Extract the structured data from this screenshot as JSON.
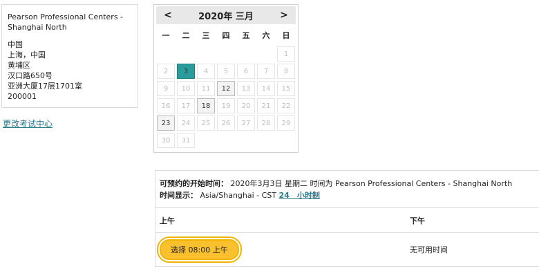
{
  "center": {
    "name": "Pearson Professional Centers - Shanghai North",
    "address": [
      "中国",
      "上海，中国",
      "黄埔区",
      "汉口路650号",
      "亚洲大厦17层1701室",
      "200001"
    ],
    "change_link": "更改考试中心"
  },
  "calendar": {
    "title": "2020年 三月",
    "prev_label": "<",
    "next_label": ">",
    "weekdays": [
      "一",
      "二",
      "三",
      "四",
      "五",
      "六",
      "日"
    ],
    "selected_day": "3",
    "available_days": [
      "3",
      "12",
      "18",
      "23"
    ]
  },
  "availability": {
    "start_label": "可预约的开始时间：",
    "start_text": "2020年3月3日 星期二 时间为 Pearson Professional Centers - Shanghai North",
    "tz_label": "时间显示：",
    "tz_text": "Asia/Shanghai - CST",
    "hour_format_link": "24　小时制",
    "morning_header": "上午",
    "afternoon_header": "下午",
    "select_button": "选择 08:00 上午",
    "no_time_text": "无可用时间"
  }
}
